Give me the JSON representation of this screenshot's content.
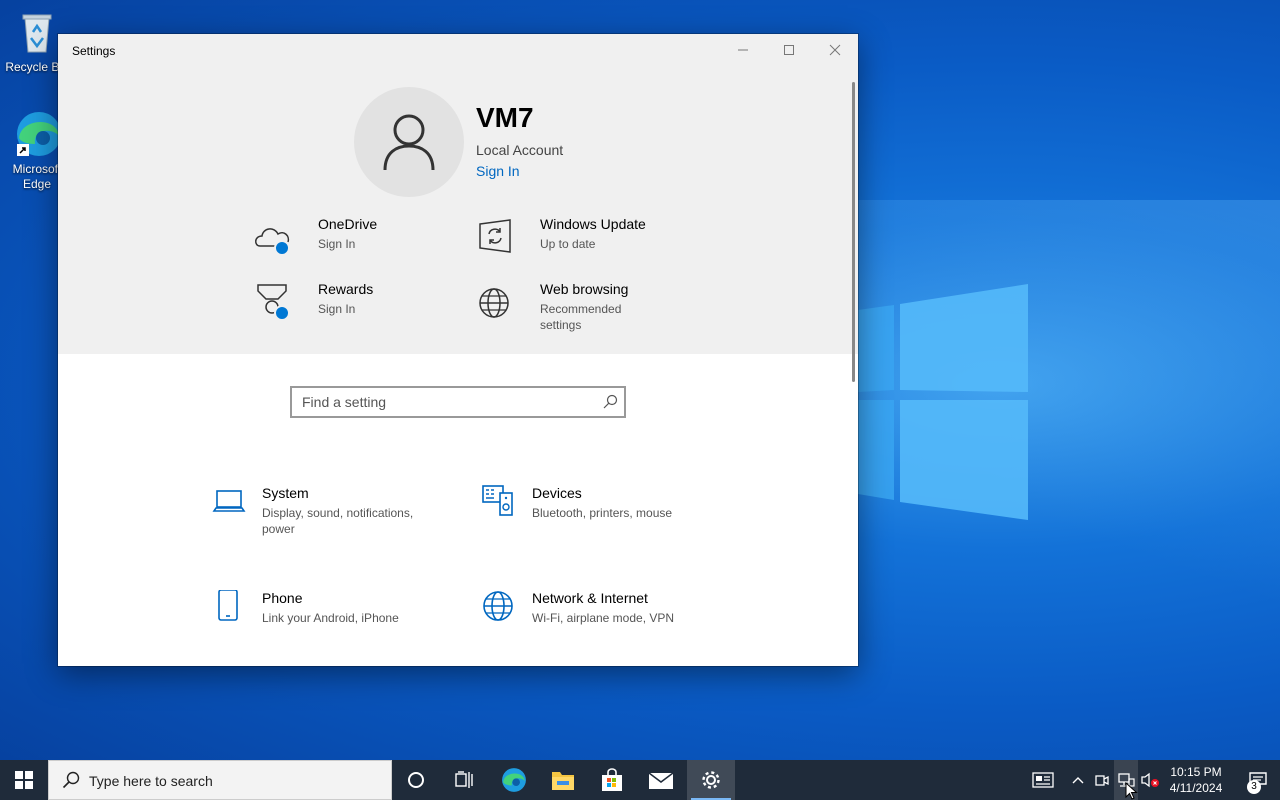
{
  "desktop": {
    "icons": [
      {
        "label": "Recycle Bin"
      },
      {
        "label": "Microsoft Edge"
      }
    ]
  },
  "settings_window": {
    "title": "Settings",
    "account": {
      "name": "VM7",
      "type": "Local Account",
      "sign_in_link": "Sign In"
    },
    "quick_tiles": [
      {
        "title": "OneDrive",
        "subtitle": "Sign In",
        "icon": "cloud-icon"
      },
      {
        "title": "Windows Update",
        "subtitle": "Up to date",
        "icon": "windows-update-icon"
      },
      {
        "title": "Rewards",
        "subtitle": "Sign In",
        "icon": "rewards-icon"
      },
      {
        "title": "Web browsing",
        "subtitle": "Recommended settings",
        "icon": "globe-icon"
      }
    ],
    "search": {
      "placeholder": "Find a setting"
    },
    "categories": [
      {
        "title": "System",
        "subtitle": "Display, sound, notifications, power",
        "icon": "laptop-icon"
      },
      {
        "title": "Devices",
        "subtitle": "Bluetooth, printers, mouse",
        "icon": "devices-icon"
      },
      {
        "title": "Phone",
        "subtitle": "Link your Android, iPhone",
        "icon": "phone-icon"
      },
      {
        "title": "Network & Internet",
        "subtitle": "Wi-Fi, airplane mode, VPN",
        "icon": "globe-icon"
      }
    ]
  },
  "taskbar": {
    "search_text": "Type here to search",
    "pinned": [
      "cortana-icon",
      "task-view-icon",
      "edge-icon",
      "file-explorer-icon",
      "store-icon",
      "mail-icon",
      "settings-icon"
    ],
    "clock": {
      "time": "10:15 PM",
      "date": "4/11/2024"
    },
    "notification_count": "3"
  },
  "colors": {
    "accent": "#0067c0",
    "taskbar": "#1f2b3a",
    "header_bg": "#f0f0f0"
  }
}
